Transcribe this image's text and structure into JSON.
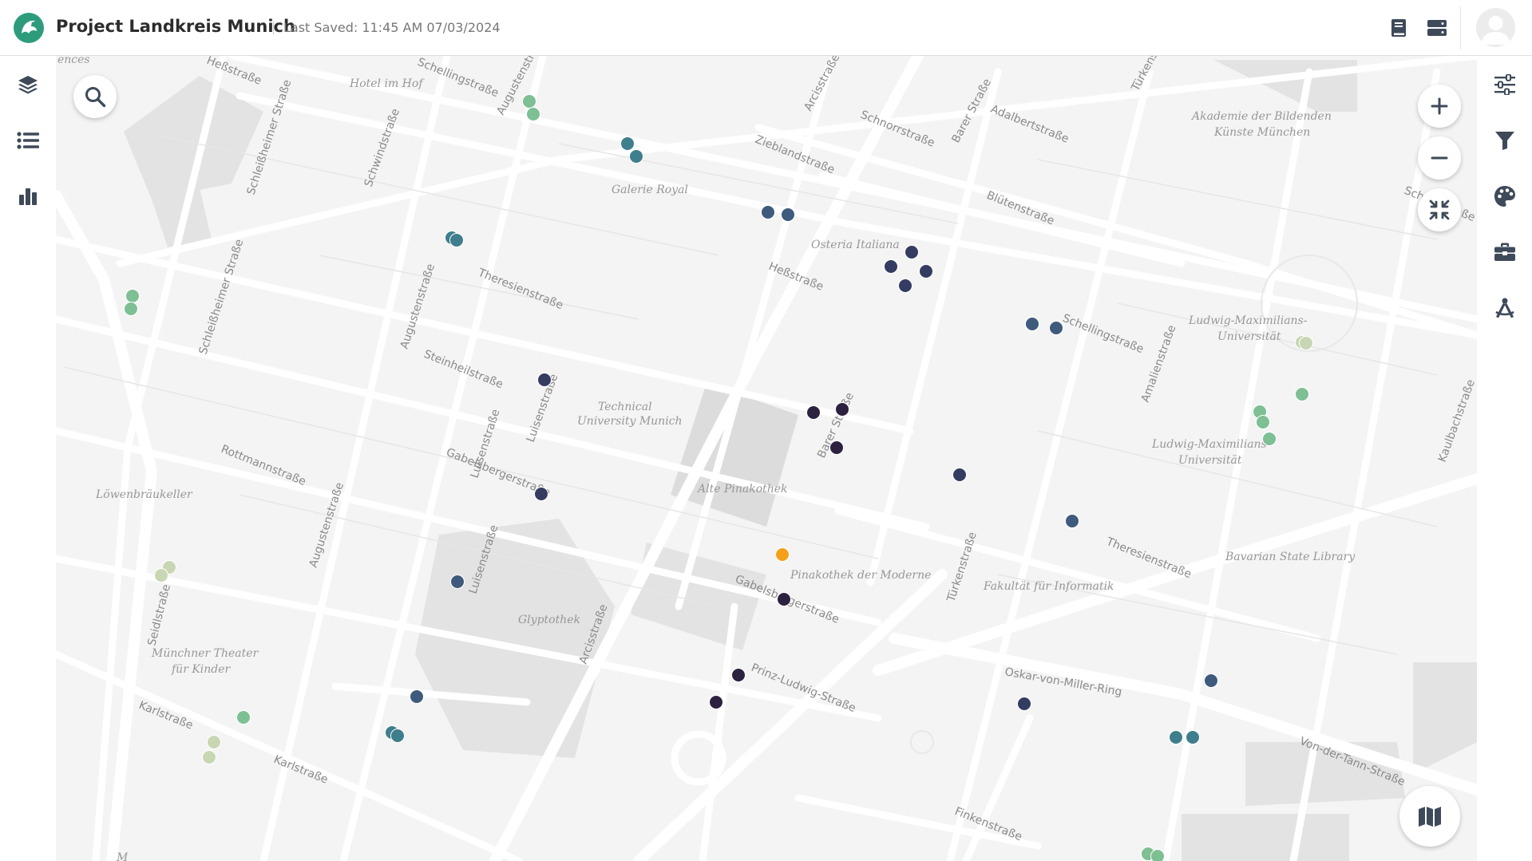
{
  "header": {
    "title": "Project Landkreis Munich",
    "last_saved": "Last Saved: 11:45 AM 07/03/2024"
  },
  "colors": {
    "brand": "#2e9c7c",
    "icon": "#3e4a5a",
    "marker_orange": "#f5a01a",
    "marker_darkest": "#2d2140",
    "marker_navy": "#353c62",
    "marker_slate": "#3e5a7c",
    "marker_teal": "#3f7e8c",
    "marker_green": "#7ebf93",
    "marker_pale": "#c9d6b3"
  },
  "left_rail": [
    {
      "icon": "layers-icon"
    },
    {
      "icon": "list-icon"
    },
    {
      "icon": "bar-chart-icon"
    }
  ],
  "right_rail": [
    {
      "icon": "sliders-icon"
    },
    {
      "icon": "filter-icon"
    },
    {
      "icon": "palette-icon"
    },
    {
      "icon": "toolbox-icon"
    },
    {
      "icon": "drafting-compass-icon"
    }
  ],
  "map": {
    "street_labels": [
      "Heßstraße",
      "Schellingstraße",
      "Augustenstraße",
      "Arcisstraße",
      "Schnorrstraße",
      "Barer Straße",
      "Adalbertstraße",
      "Türkenstraße",
      "Zieblandstraße",
      "Blütenstraße",
      "Schackstraße",
      "Theresienstraße",
      "Steinheilstraße",
      "Luisenstraße",
      "Gabelsbergerstraße",
      "Rottmannstraße",
      "Schleißheimer Straße",
      "Schwindstraße",
      "Amalienstraße",
      "Kaulbachstraße",
      "Seidlstraße",
      "Karlstraße",
      "Prinz-Ludwig-Straße",
      "Oskar-von-Miller-Ring",
      "Von-der-Tann-Straße",
      "Finkenstraße",
      "Barer Straße",
      "Türkenstraße",
      "Theresienstraße",
      "Gabelsbergerstraße",
      "Arcisstraße",
      "Luisenstraße",
      "Augustenstraße",
      "Augustenstraße",
      "Karlstraße",
      "Luisenstraße",
      "Schellingstraße",
      "Heßstraße",
      "Schleißheimer Straße"
    ],
    "poi_labels": [
      "Hotel im Hof",
      "Galerie Royal",
      "Osteria Italiana",
      "Technical",
      "University Munich",
      "Alte Pinakothek",
      "Pinakothek der Moderne",
      "Glyptothek",
      "Löwenbräukeller",
      "Münchner Theater",
      "für Kinder",
      "Akademie der Bildenden",
      "Künste München",
      "Ludwig-Maximilians-",
      "Universität",
      "Ludwig-Maximilians-",
      "Universität",
      "Bavarian State Library",
      "Fakultät für Informatik",
      "ences",
      "M"
    ],
    "marker_count": 53
  }
}
